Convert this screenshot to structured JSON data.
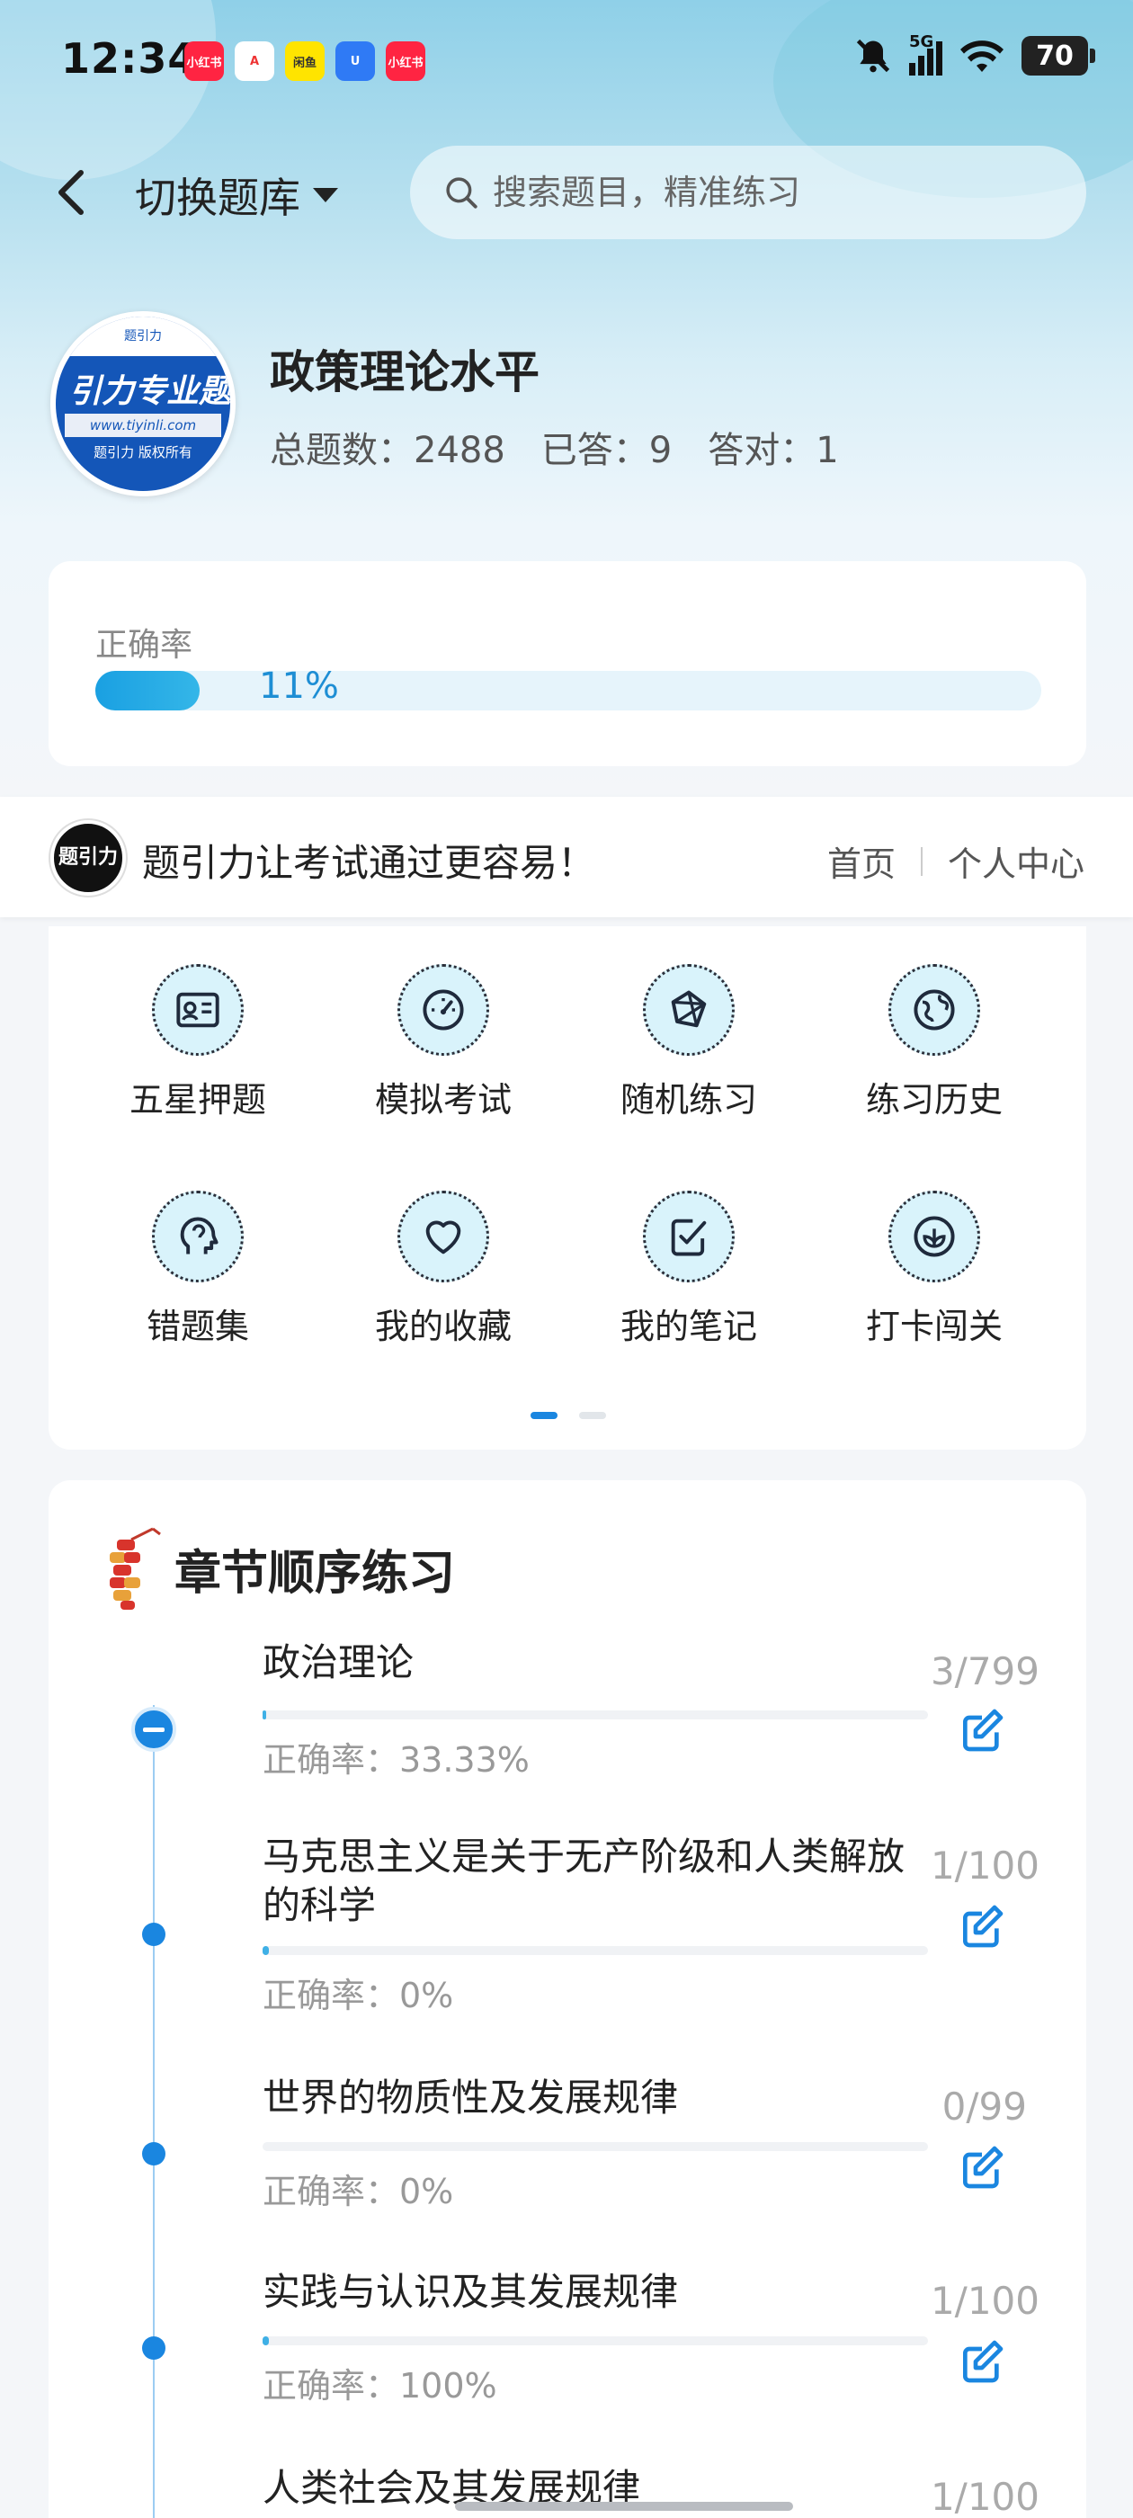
{
  "status_bar": {
    "time": "12:34",
    "notifications": [
      {
        "label": "小红书",
        "color": "#ff2442"
      },
      {
        "label": "A",
        "color": "#ffffff"
      },
      {
        "label": "闲鱼",
        "color": "#ffe400"
      },
      {
        "label": "U",
        "color": "#2f7af5"
      },
      {
        "label": "小红书",
        "color": "#ff2442"
      }
    ],
    "network": "5G",
    "battery": "70"
  },
  "header": {
    "switch_label": "切换题库",
    "search_placeholder": "搜索题目，精准练习"
  },
  "bank": {
    "logo": {
      "top_text": "题引力",
      "main_text": "引力专业题",
      "url": "www.tiyinli.com",
      "copyright": "题引力 版权所有"
    },
    "title": "政策理论水平",
    "stats": {
      "total": "总题数：2488",
      "answered": "已答：9",
      "correct": "答对：1"
    }
  },
  "accuracy": {
    "label": "正确率",
    "value": "11%",
    "fraction": 0.11
  },
  "brand_bar": {
    "logo_text": "题引力",
    "slogan": "题引力让考试通过更容易！",
    "nav_home": "首页",
    "nav_profile": "个人中心"
  },
  "functions": [
    {
      "label": "五星押题",
      "icon": "id-card-icon"
    },
    {
      "label": "模拟考试",
      "icon": "speedometer-icon"
    },
    {
      "label": "随机练习",
      "icon": "network-icon"
    },
    {
      "label": "练习历史",
      "icon": "globe-icon"
    },
    {
      "label": "错题集",
      "icon": "head-icon"
    },
    {
      "label": "我的收藏",
      "icon": "heart-icon"
    },
    {
      "label": "我的笔记",
      "icon": "checkbox-icon"
    },
    {
      "label": "打卡闯关",
      "icon": "leaf-icon"
    }
  ],
  "chapters": {
    "title": "章节顺序练习",
    "items": [
      {
        "name": "政治理论",
        "accuracy": "正确率：33.33%",
        "count": "3/799",
        "progress": 0.004,
        "expanded": true
      },
      {
        "name": "马克思主义是关于无产阶级和人类解放的科学",
        "accuracy": "正确率：0%",
        "count": "1/100",
        "progress": 0.01,
        "expanded": false
      },
      {
        "name": "世界的物质性及发展规律",
        "accuracy": "正确率：0%",
        "count": "0/99",
        "progress": 0,
        "expanded": false
      },
      {
        "name": "实践与认识及其发展规律",
        "accuracy": "正确率：100%",
        "count": "1/100",
        "progress": 0.01,
        "expanded": false
      },
      {
        "name": "人类社会及其发展规律",
        "accuracy": "",
        "count": "1/100",
        "progress": 0.01,
        "expanded": false
      }
    ]
  },
  "colors": {
    "accent": "#1a86e0",
    "progress": "#34b6e8"
  }
}
